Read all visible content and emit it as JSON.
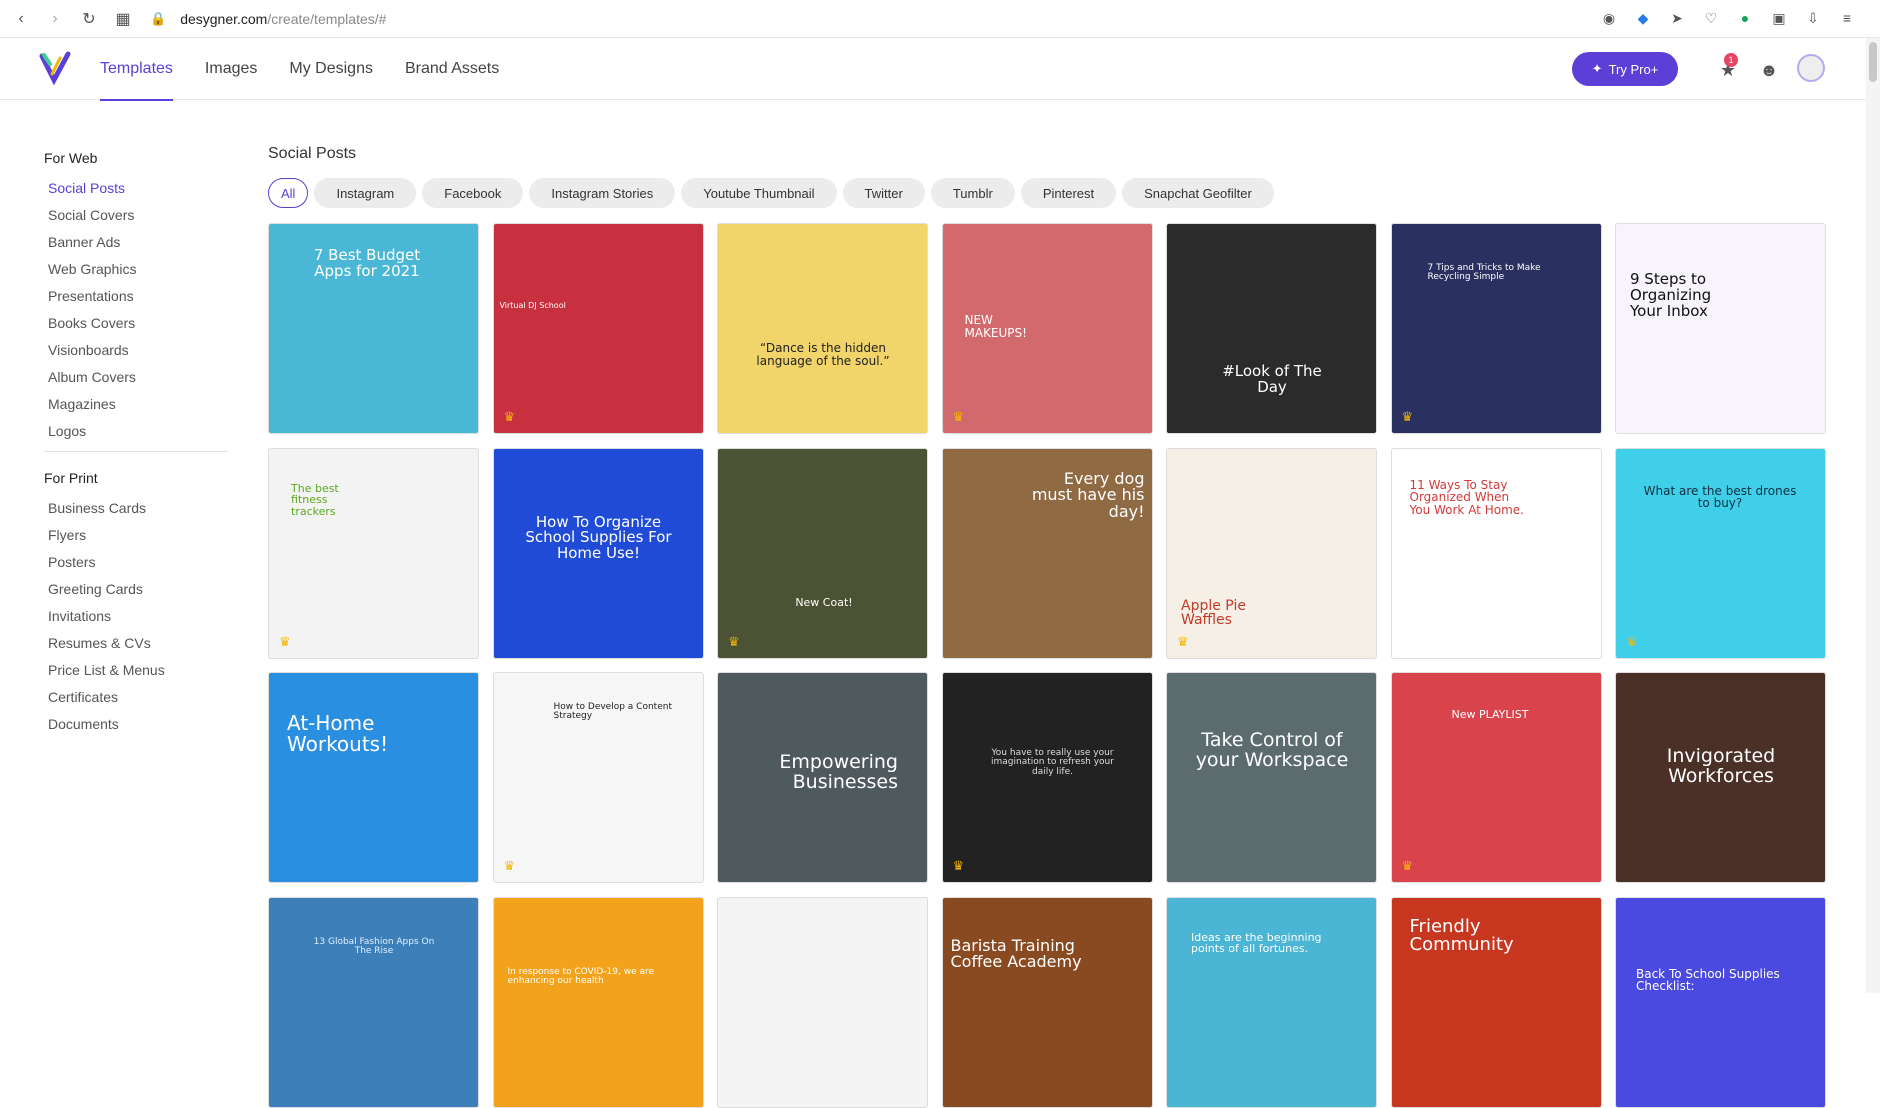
{
  "browser": {
    "url_host": "desygner.com",
    "url_path": "/create/templates/#"
  },
  "header": {
    "nav": [
      {
        "label": "Templates",
        "active": true
      },
      {
        "label": "Images",
        "active": false
      },
      {
        "label": "My Designs",
        "active": false
      },
      {
        "label": "Brand Assets",
        "active": false
      }
    ],
    "try_pro_label": "Try Pro+",
    "notification_count": "1",
    "accent": "#5b3fd6"
  },
  "sidebar": {
    "web_heading": "For Web",
    "web_items": [
      "Social Posts",
      "Social Covers",
      "Banner Ads",
      "Web Graphics",
      "Presentations",
      "Books Covers",
      "Visionboards",
      "Album Covers",
      "Magazines",
      "Logos"
    ],
    "print_heading": "For Print",
    "print_items": [
      "Business Cards",
      "Flyers",
      "Posters",
      "Greeting Cards",
      "Invitations",
      "Resumes & CVs",
      "Price List & Menus",
      "Certificates",
      "Documents"
    ]
  },
  "main": {
    "section_title": "Social Posts",
    "filters": [
      "All",
      "Instagram",
      "Facebook",
      "Instagram Stories",
      "Youtube Thumbnail",
      "Twitter",
      "Tumblr",
      "Pinterest",
      "Snapchat Geofilter"
    ],
    "templates": [
      {
        "text": "7 Best Budget Apps for 2021",
        "bg": "#4bb7d6",
        "fg": "#ffffff",
        "pro": false
      },
      {
        "text": "Virtual DJ School",
        "bg": "#c8303f",
        "fg": "#ffffff",
        "pro": true
      },
      {
        "text": "“Dance is the hidden language of the soul.”",
        "bg": "#f1d46a",
        "fg": "#222222",
        "pro": false
      },
      {
        "text": "NEW MAKEUPS!",
        "bg": "#d26a6d",
        "fg": "#ffffff",
        "pro": true
      },
      {
        "text": "#Look of The Day",
        "bg": "#2b2b2b",
        "fg": "#ffffff",
        "pro": false
      },
      {
        "text": "7 Tips and Tricks to Make Recycling Simple",
        "bg": "#2a3160",
        "fg": "#ffffff",
        "pro": true
      },
      {
        "text": "9 Steps to Organizing Your Inbox",
        "bg": "#f7f4fb",
        "fg": "#111111",
        "pro": false
      },
      {
        "text": "The best fitness trackers",
        "bg": "#f3f3f3",
        "fg": "#5ba91f",
        "pro": true
      },
      {
        "text": "How To Organize School Supplies For Home Use!",
        "bg": "#1f4bd6",
        "fg": "#ffffff",
        "pro": false
      },
      {
        "text": "New Coat!",
        "bg": "#4c5234",
        "fg": "#ffffff",
        "pro": true
      },
      {
        "text": "Every dog must have his day!",
        "bg": "#8f6a43",
        "fg": "#ffffff",
        "pro": false
      },
      {
        "text": "Apple Pie Waffles",
        "bg": "#f5efe6",
        "fg": "#c23b2a",
        "pro": true
      },
      {
        "text": "11 Ways To Stay Organized When You Work At Home.",
        "bg": "#ffffff",
        "fg": "#d33a3a",
        "pro": false
      },
      {
        "text": "What are the best drones to buy?",
        "bg": "#3fcfe8",
        "fg": "#123040",
        "pro": true
      },
      {
        "text": "At-Home Workouts!",
        "bg": "#2a8fe0",
        "fg": "#ffffff",
        "pro": false
      },
      {
        "text": "How to Develop a Content Strategy",
        "bg": "#f6f6f6",
        "fg": "#222222",
        "pro": true
      },
      {
        "text": "Empowering Businesses",
        "bg": "#4f5a5e",
        "fg": "#ffffff",
        "pro": false
      },
      {
        "text": "You have to really use your imagination to refresh your daily life.",
        "bg": "#222222",
        "fg": "#dddddd",
        "pro": true
      },
      {
        "text": "Take Control of your Workspace",
        "bg": "#5b6b6e",
        "fg": "#ffffff",
        "pro": false
      },
      {
        "text": "New PLAYLIST",
        "bg": "#d9434c",
        "fg": "#ffffff",
        "pro": true
      },
      {
        "text": "Invigorated Workforces",
        "bg": "#4a3026",
        "fg": "#ffffff",
        "pro": false
      },
      {
        "text": "13 Global Fashion Apps On The Rise",
        "bg": "#3d7fb8",
        "fg": "#dfefff",
        "pro": false
      },
      {
        "text": "In response to COVID-19, we are enhancing our health",
        "bg": "#f3a31b",
        "fg": "#ffffff",
        "pro": false
      },
      {
        "text": "",
        "bg": "#f4f4f4",
        "fg": "#222222",
        "pro": false
      },
      {
        "text": "Barista Training Coffee Academy",
        "bg": "#8a4a21",
        "fg": "#ffffff",
        "pro": false
      },
      {
        "text": "Ideas are the beginning points of all fortunes.",
        "bg": "#4ab5d4",
        "fg": "#ffffff",
        "pro": false
      },
      {
        "text": "Friendly Community",
        "bg": "#c7371f",
        "fg": "#ffffff",
        "pro": false
      },
      {
        "text": "Back To School Supplies Checklist:",
        "bg": "#4a4ae0",
        "fg": "#ffffff",
        "pro": false
      }
    ]
  }
}
